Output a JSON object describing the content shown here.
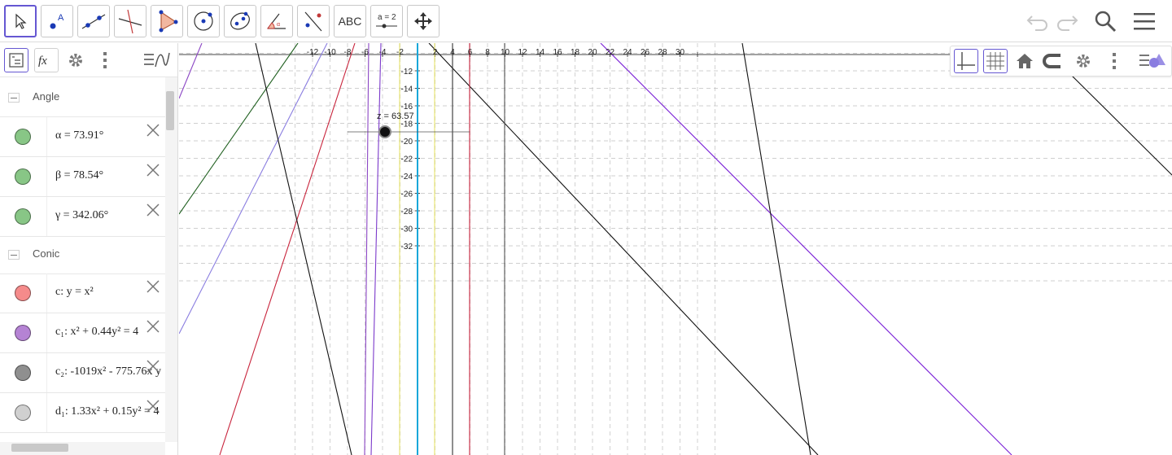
{
  "toolbar": {
    "tools": [
      {
        "name": "move-tool",
        "icon": "arrow-cursor-icon",
        "active": true
      },
      {
        "name": "point-tool",
        "icon": "point-icon"
      },
      {
        "name": "line-tool",
        "icon": "line-through-points-icon"
      },
      {
        "name": "perpendicular-line-tool",
        "icon": "perpendicular-icon"
      },
      {
        "name": "polygon-tool",
        "icon": "polygon-icon"
      },
      {
        "name": "circle-tool",
        "icon": "circle-center-point-icon"
      },
      {
        "name": "ellipse-tool",
        "icon": "ellipse-icon"
      },
      {
        "name": "angle-tool",
        "icon": "angle-icon"
      },
      {
        "name": "reflect-tool",
        "icon": "reflect-about-line-icon"
      },
      {
        "name": "text-tool",
        "label": "ABC"
      },
      {
        "name": "slider-tool",
        "label": "a = 2"
      },
      {
        "name": "move-graphics-view-tool",
        "icon": "move-arrows-icon"
      }
    ],
    "right": [
      "undo-icon",
      "redo-icon",
      "search-icon",
      "menu-icon"
    ]
  },
  "algebra": {
    "header_icons": [
      "algebra-view-icon",
      "input-fx-icon",
      "settings-icon",
      "more-vertical-icon",
      "algebra-style-icon"
    ],
    "groups": [
      {
        "label": "Angle",
        "items": [
          {
            "color": "#88c686",
            "expr": "α = 73.91°"
          },
          {
            "color": "#88c686",
            "expr": "β = 78.54°"
          },
          {
            "color": "#88c686",
            "expr": "γ = 342.06°"
          }
        ]
      },
      {
        "label": "Conic",
        "items": [
          {
            "color": "#f58b8b",
            "expr": "c: y = x²"
          },
          {
            "color": "#b583d4",
            "expr": "c₁: x² + 0.44y² = 4"
          },
          {
            "color": "#8f8f8f",
            "expr": "c₂: -1019x² - 775.76x y"
          },
          {
            "color": "#d0d0d0",
            "expr": "d₁: 1.33x² + 0.15y² = 4"
          }
        ]
      }
    ]
  },
  "graphics": {
    "x_ticks": [
      "-12",
      "-10",
      "-8",
      "-6",
      "-4",
      "-2",
      "2",
      "4",
      "6",
      "8",
      "10",
      "12",
      "14",
      "16",
      "18",
      "20",
      "22",
      "24",
      "26",
      "28",
      "30"
    ],
    "y_ticks": [
      "-12",
      "-14",
      "-16",
      "-18",
      "-20",
      "-22",
      "-24",
      "-26",
      "-28",
      "-30",
      "-32"
    ],
    "slider_label": "z = 63.57",
    "style_bar_icons": [
      "axes-toggle-icon",
      "grid-toggle-icon",
      "home-icon",
      "snap-magnet-icon",
      "settings-icon",
      "more-vertical-icon",
      "graphics-style-icon"
    ]
  },
  "colors": {
    "accent": "#6557d2",
    "grid": "#c0c0c0"
  }
}
